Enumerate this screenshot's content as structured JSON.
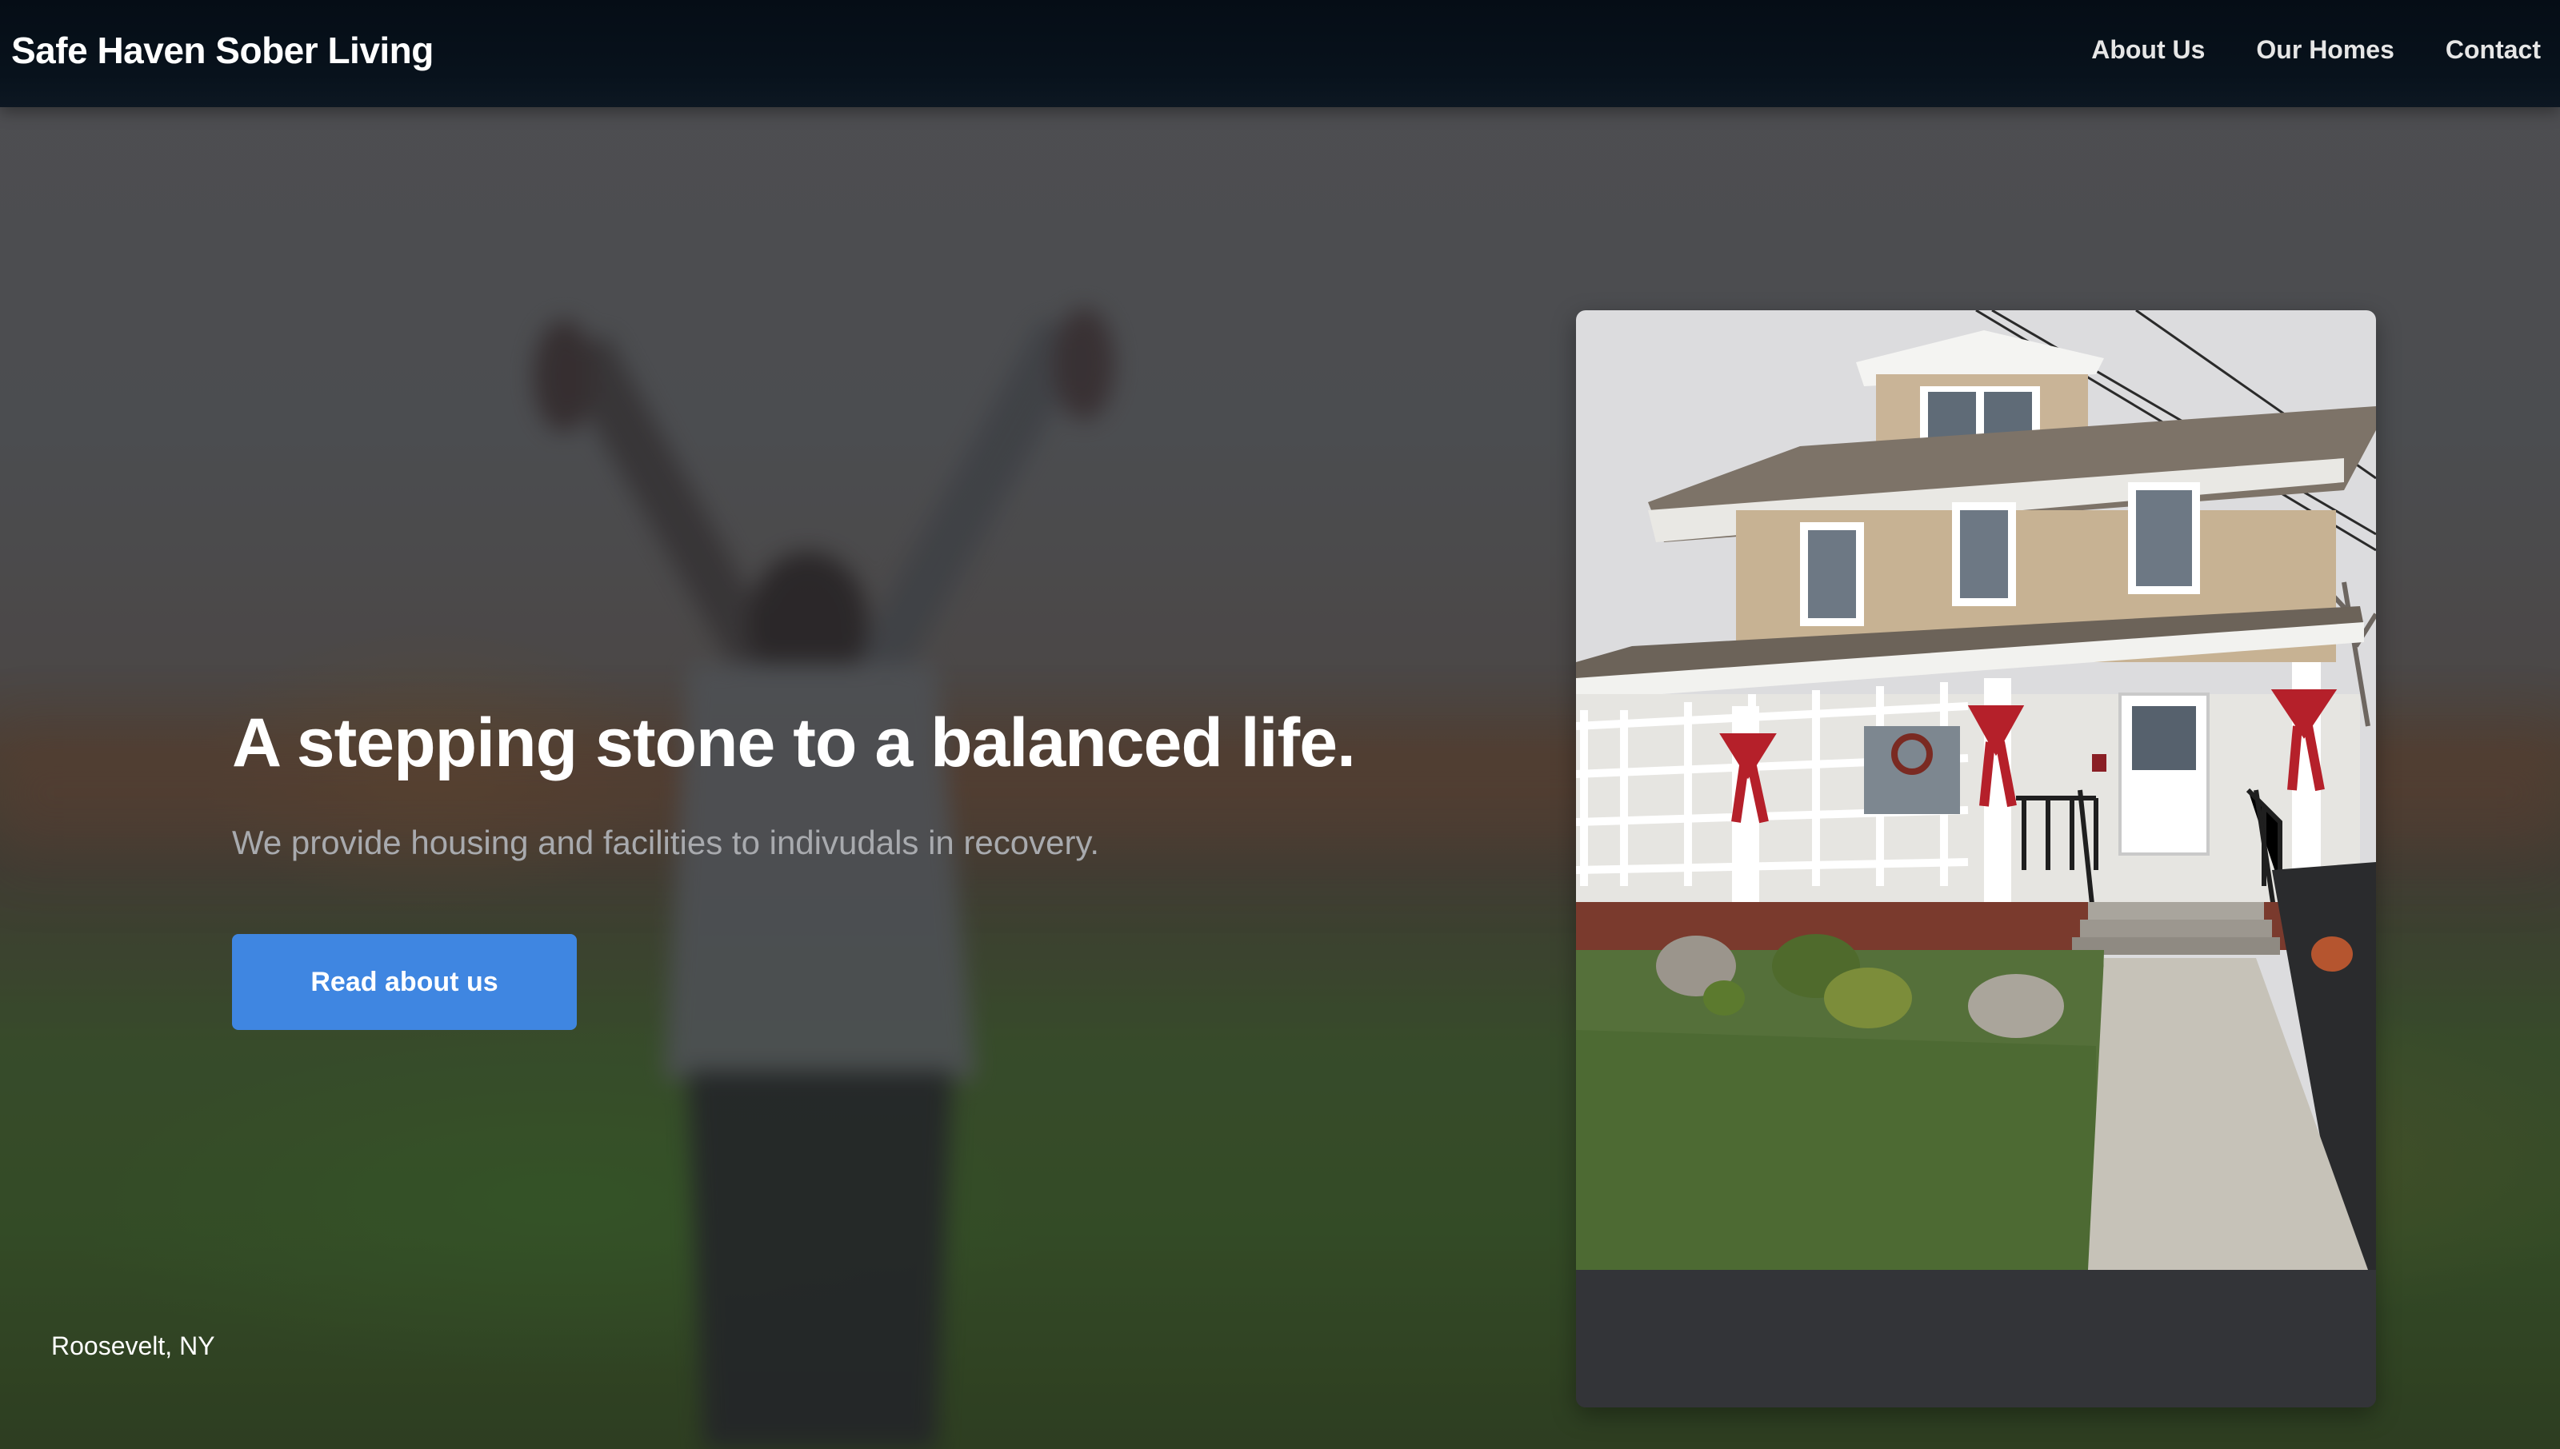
{
  "nav": {
    "brand": "Safe Haven Sober Living",
    "links": [
      "About Us",
      "Our Homes",
      "Contact"
    ]
  },
  "hero": {
    "headline": "A stepping stone to a balanced life.",
    "subheadline": "We provide housing and facilities to indivudals in recovery.",
    "cta_label": "Read about us"
  },
  "featured_home": {
    "location": "Roosevelt, NY"
  },
  "colors": {
    "navbar": "#050d16",
    "cta": "#3f86e1",
    "caption_bg": "#333438"
  },
  "icons": {
    "background": "person-arms-raised-photo",
    "home_photo": "house-photo"
  }
}
